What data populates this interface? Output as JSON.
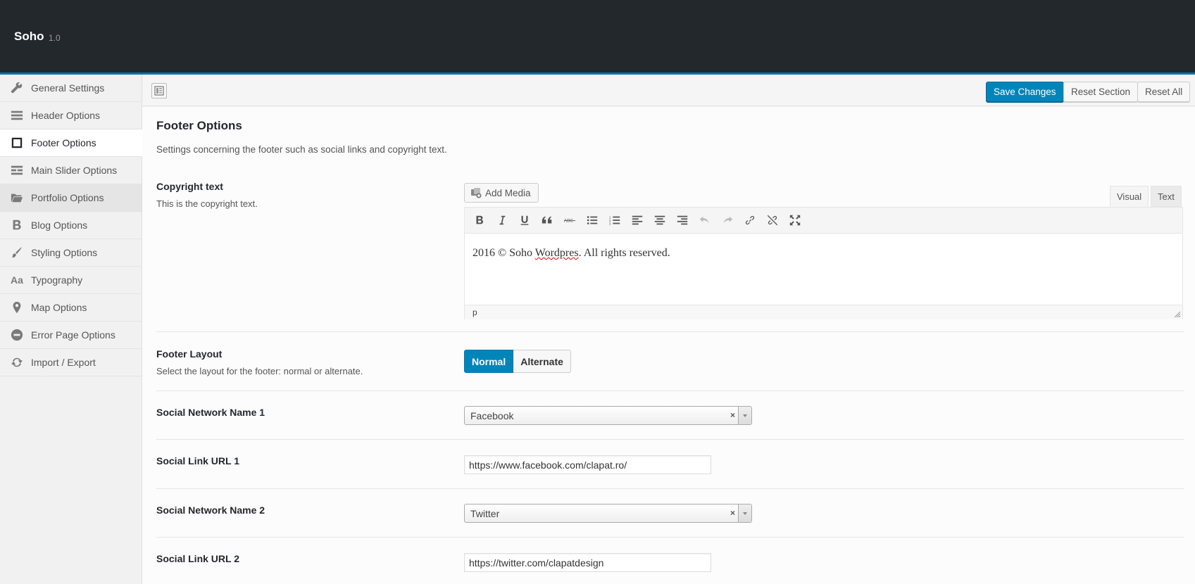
{
  "header": {
    "brand": "Soho",
    "version": "1.0"
  },
  "sidebar": {
    "items": [
      {
        "label": "General Settings",
        "icon": "wrench-icon"
      },
      {
        "label": "Header Options",
        "icon": "menu-lines-icon"
      },
      {
        "label": "Footer Options",
        "icon": "square-outline-icon",
        "active": true
      },
      {
        "label": "Main Slider Options",
        "icon": "slider-lines-icon"
      },
      {
        "label": "Portfolio Options",
        "icon": "folder-open-icon"
      },
      {
        "label": "Blog Options",
        "icon": "bold-b-icon"
      },
      {
        "label": "Styling Options",
        "icon": "brush-icon"
      },
      {
        "label": "Typography",
        "icon": "typography-aa-icon"
      },
      {
        "label": "Map Options",
        "icon": "map-marker-icon"
      },
      {
        "label": "Error Page Options",
        "icon": "minus-circle-icon"
      },
      {
        "label": "Import / Export",
        "icon": "refresh-icon"
      }
    ]
  },
  "toolbar": {
    "save_label": "Save Changes",
    "reset_section_label": "Reset Section",
    "reset_all_label": "Reset All"
  },
  "section": {
    "title": "Footer Options",
    "description": "Settings concerning the footer such as social links and copyright text."
  },
  "fields": {
    "copyright": {
      "title": "Copyright text",
      "description": "This is the copyright text.",
      "add_media_label": "Add Media",
      "tab_visual": "Visual",
      "tab_text": "Text",
      "content_before": "2016 © Soho ",
      "content_misspelled": "Wordpres",
      "content_after": ". All rights reserved.",
      "status_path": "p"
    },
    "footer_layout": {
      "title": "Footer Layout",
      "description": "Select the layout for the footer: normal or alternate.",
      "options": [
        "Normal",
        "Alternate"
      ],
      "selected": "Normal"
    },
    "social_name_1": {
      "title": "Social Network Name 1",
      "value": "Facebook"
    },
    "social_url_1": {
      "title": "Social Link URL 1",
      "value": "https://www.facebook.com/clapat.ro/"
    },
    "social_name_2": {
      "title": "Social Network Name 2",
      "value": "Twitter"
    },
    "social_url_2": {
      "title": "Social Link URL 2",
      "value": "https://twitter.com/clapatdesign"
    }
  },
  "colors": {
    "accent": "#0085ba",
    "header_bg": "#23282d"
  }
}
